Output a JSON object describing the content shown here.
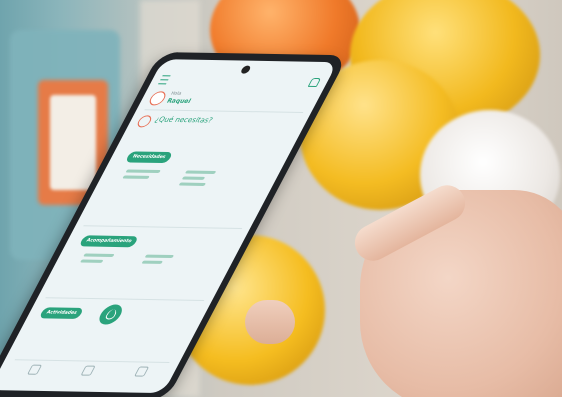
{
  "screen": {
    "greeting_small": "Hola",
    "greeting_name": "Raquel",
    "question": "¿Qué necesitas?",
    "sections": [
      {
        "label": "Necesidades"
      },
      {
        "label": "Acompañamiento"
      },
      {
        "label": "Actividades"
      }
    ]
  },
  "colors": {
    "accent": "#2aa37c",
    "accent_secondary": "#e86f55",
    "screen_bg": "#edf4f6"
  },
  "icons": [
    "menu-icon",
    "bell-icon",
    "avatar-icon",
    "question-icon",
    "leaf-icon"
  ]
}
